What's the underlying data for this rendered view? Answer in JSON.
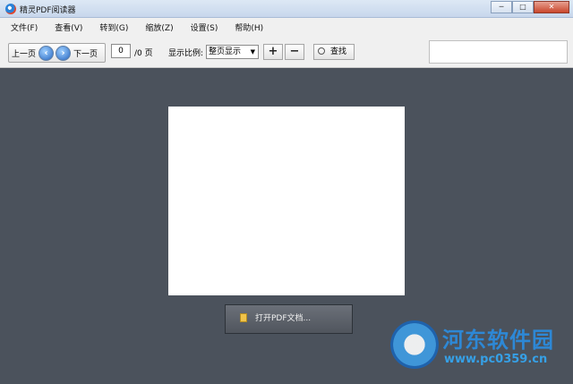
{
  "window": {
    "title": "精灵PDF阅读器",
    "controls": {
      "minimize": "─",
      "maximize": "□",
      "close": "✕"
    }
  },
  "menu": [
    "文件(F)",
    "查看(V)",
    "转到(G)",
    "缩放(Z)",
    "设置(S)",
    "帮助(H)"
  ],
  "toolbar": {
    "prev_label": "上一页",
    "next_label": "下一页",
    "page_value": "0",
    "page_total": "/0 页",
    "zoom_label": "显示比例:",
    "zoom_value": "整页显示",
    "zoom_in": "+",
    "zoom_out": "−",
    "find_label": "查找"
  },
  "document": {
    "open_button": "打开PDF文档..."
  },
  "watermark": {
    "name": "河东软件园",
    "url": "www.pc0359.cn"
  },
  "icons": {
    "prev": "arrow-left-icon",
    "next": "arrow-right-icon",
    "find": "magnifier-icon",
    "open": "document-icon"
  }
}
